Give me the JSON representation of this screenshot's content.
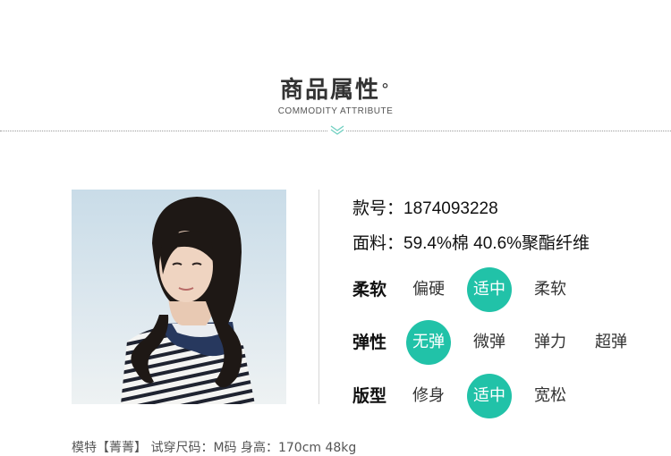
{
  "header": {
    "title": "商品属性",
    "title_mark": "°",
    "subtitle": "COMMODITY ATTRIBUTE"
  },
  "product": {
    "code_label": "款号：",
    "code_value": "1874093228",
    "fabric_label": "面料：",
    "fabric_value": "59.4%棉 40.6%聚酯纤维"
  },
  "attributes": [
    {
      "label": "柔软",
      "options": [
        "偏硬",
        "适中",
        "柔软"
      ],
      "selected": 1
    },
    {
      "label": "弹性",
      "options": [
        "无弹",
        "微弹",
        "弹力",
        "超弹"
      ],
      "selected": 0
    },
    {
      "label": "版型",
      "options": [
        "修身",
        "适中",
        "宽松"
      ],
      "selected": 1
    }
  ],
  "footer": {
    "text": "模特【菁菁】 试穿尺码：M码 身高：170cm 48kg"
  },
  "colors": {
    "accent": "#21c2a8",
    "chevron": "#6fcfc0"
  }
}
